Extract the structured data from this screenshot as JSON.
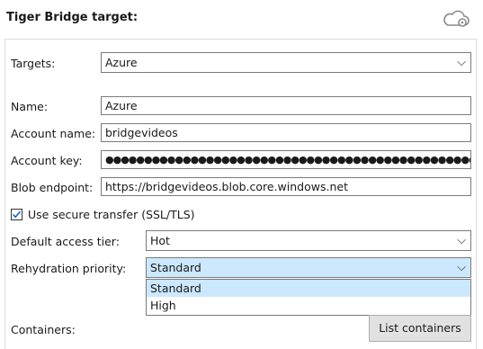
{
  "header": {
    "title": "Tiger Bridge target:",
    "icon": "cloud-settings-icon"
  },
  "form": {
    "targets_label": "Targets:",
    "targets_value": "Azure",
    "name_label": "Name:",
    "name_value": "Azure",
    "account_name_label": "Account name:",
    "account_name_value": "bridgevideos",
    "account_key_label": "Account key:",
    "account_key_value": "●●●●●●●●●●●●●●●●●●●●●●●●●●●●●●●●●●●●●●●●●●●●●●●●●●●●●●●●●●●●●●●●●●●●●●●●●●●●●●",
    "blob_endpoint_label": "Blob endpoint:",
    "blob_endpoint_value": "https://bridgevideos.blob.core.windows.net",
    "secure_transfer_label": "Use secure transfer (SSL/TLS)",
    "secure_transfer_checked": true,
    "default_tier_label": "Default access tier:",
    "default_tier_value": "Hot",
    "rehydration_label": "Rehydration priority:",
    "rehydration_value": "Standard",
    "rehydration_options": [
      "Standard",
      "High"
    ],
    "containers_label": "Containers:",
    "list_containers_button": "List containers"
  }
}
